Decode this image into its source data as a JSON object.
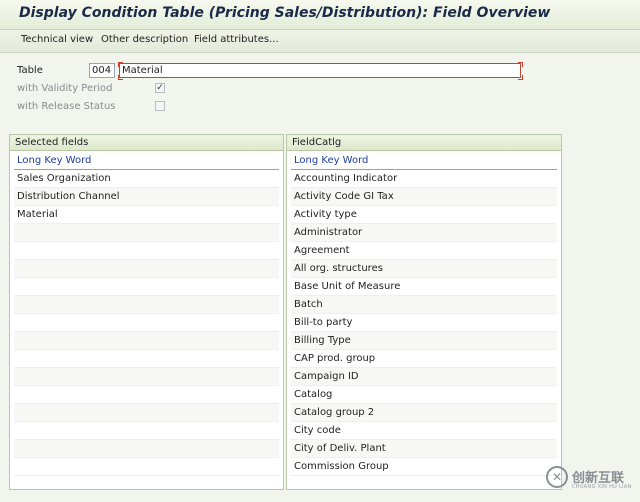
{
  "window": {
    "title": "Display Condition Table (Pricing Sales/Distribution): Field Overview"
  },
  "toolbar": {
    "items": [
      "Technical view",
      "Other description",
      "Field attributes..."
    ]
  },
  "header_fields": {
    "table_label": "Table",
    "table_number": "004",
    "table_desc": "Material",
    "validity_label": "with Validity Period",
    "validity_checked": true,
    "release_label": "with Release Status",
    "release_checked": false
  },
  "selected_fields": {
    "title": "Selected fields",
    "column_header": "Long Key Word",
    "items": [
      "Sales Organization",
      "Distribution Channel",
      "Material"
    ]
  },
  "field_catalog": {
    "title": "FieldCatlg",
    "column_header": "Long Key Word",
    "items": [
      "Accounting Indicator",
      "Activity Code GI Tax",
      "Activity type",
      "Administrator",
      "Agreement",
      "All org. structures",
      "Base Unit of Measure",
      "Batch",
      "Bill-to party",
      "Billing Type",
      "CAP prod. group",
      "Campaign ID",
      "Catalog",
      "Catalog group 2",
      "City code",
      "City of Deliv. Plant",
      "Commission Group"
    ]
  },
  "watermark": {
    "text": "创新互联",
    "subtext": "CHUANG XIN HU LIAN"
  }
}
